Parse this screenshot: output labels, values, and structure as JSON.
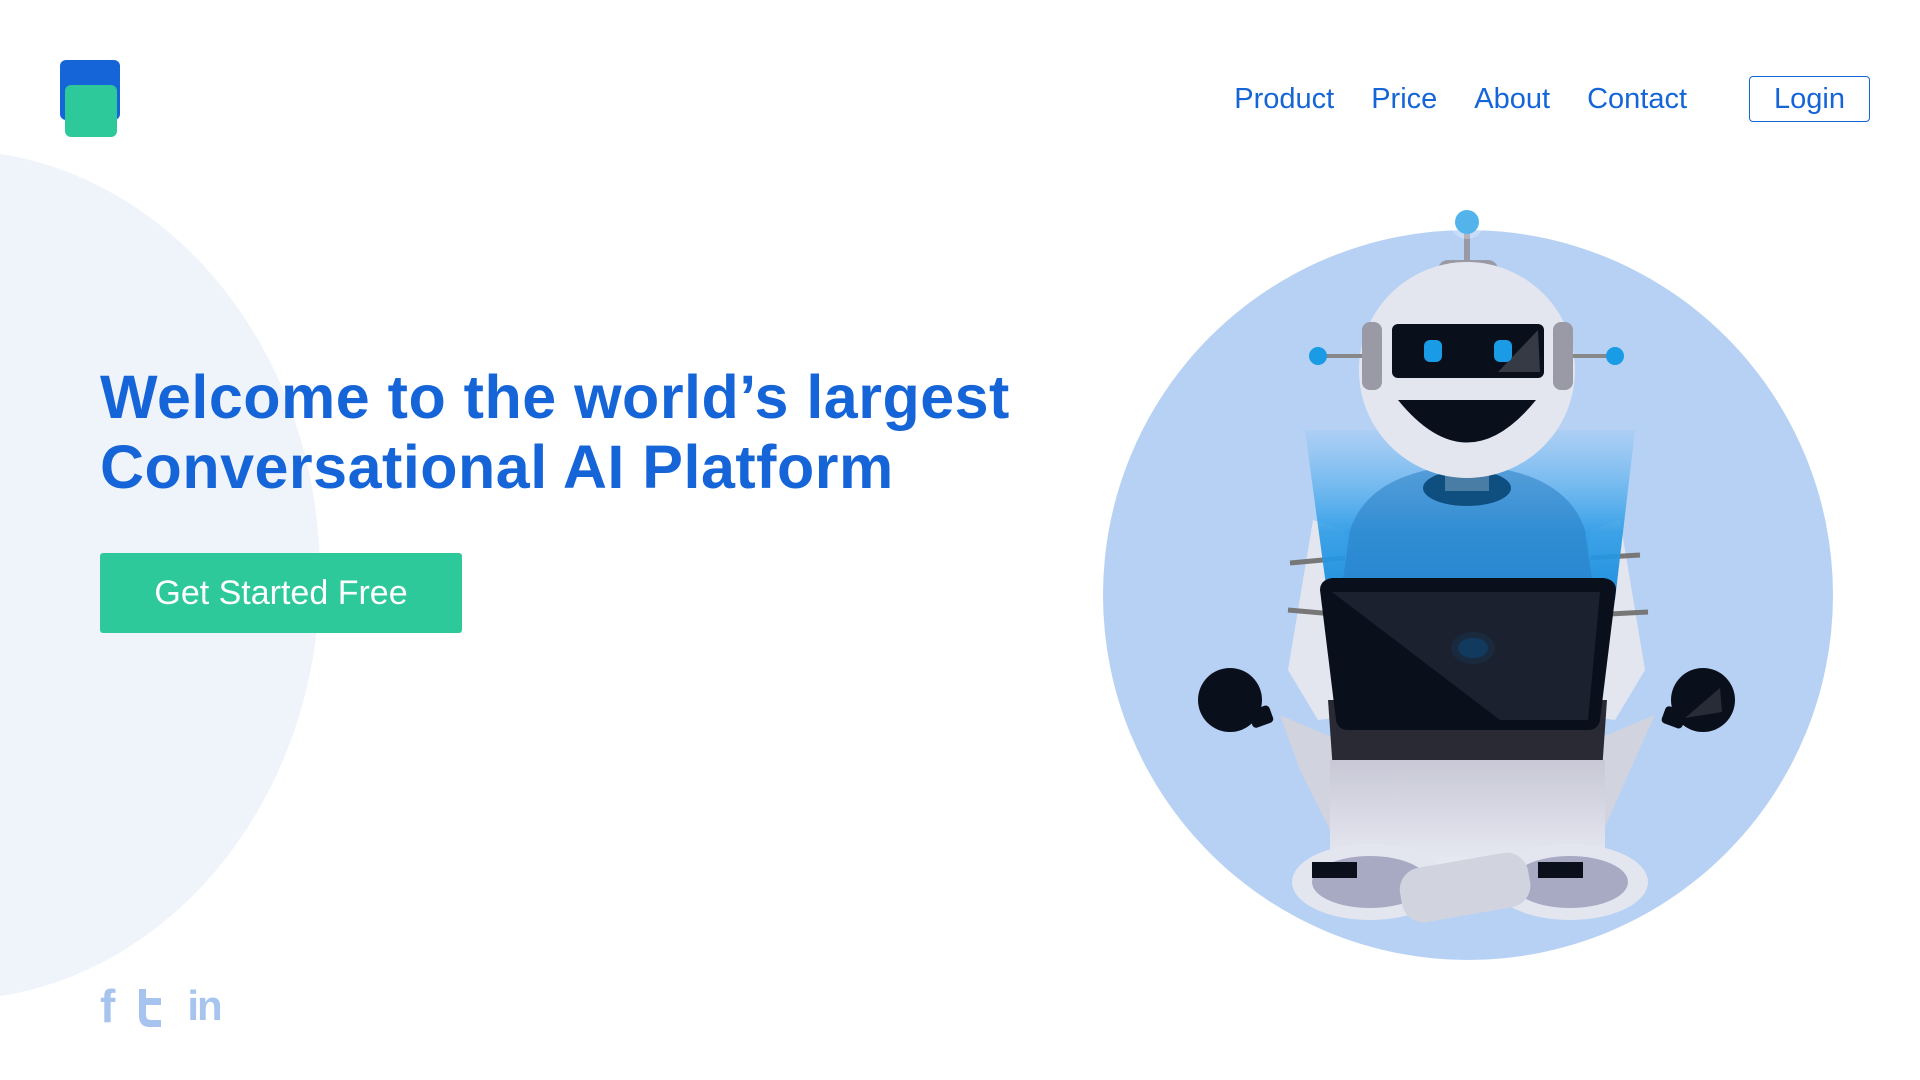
{
  "nav": {
    "items": [
      "Product",
      "Price",
      "About",
      "Contact"
    ],
    "login_label": "Login"
  },
  "hero": {
    "title_line1": "Welcome to the world’s largest",
    "title_line2": "Conversational AI Platform",
    "cta_label": "Get Started Free"
  },
  "social": {
    "icons": [
      "facebook-icon",
      "twitter-icon",
      "linkedin-icon"
    ],
    "facebook_glyph": "f",
    "linkedin_glyph": "in"
  },
  "colors": {
    "brand_blue": "#1565d8",
    "brand_green": "#2ec99a",
    "circle_bg": "#b7d1f5",
    "social_icon": "#a7c4ef"
  }
}
